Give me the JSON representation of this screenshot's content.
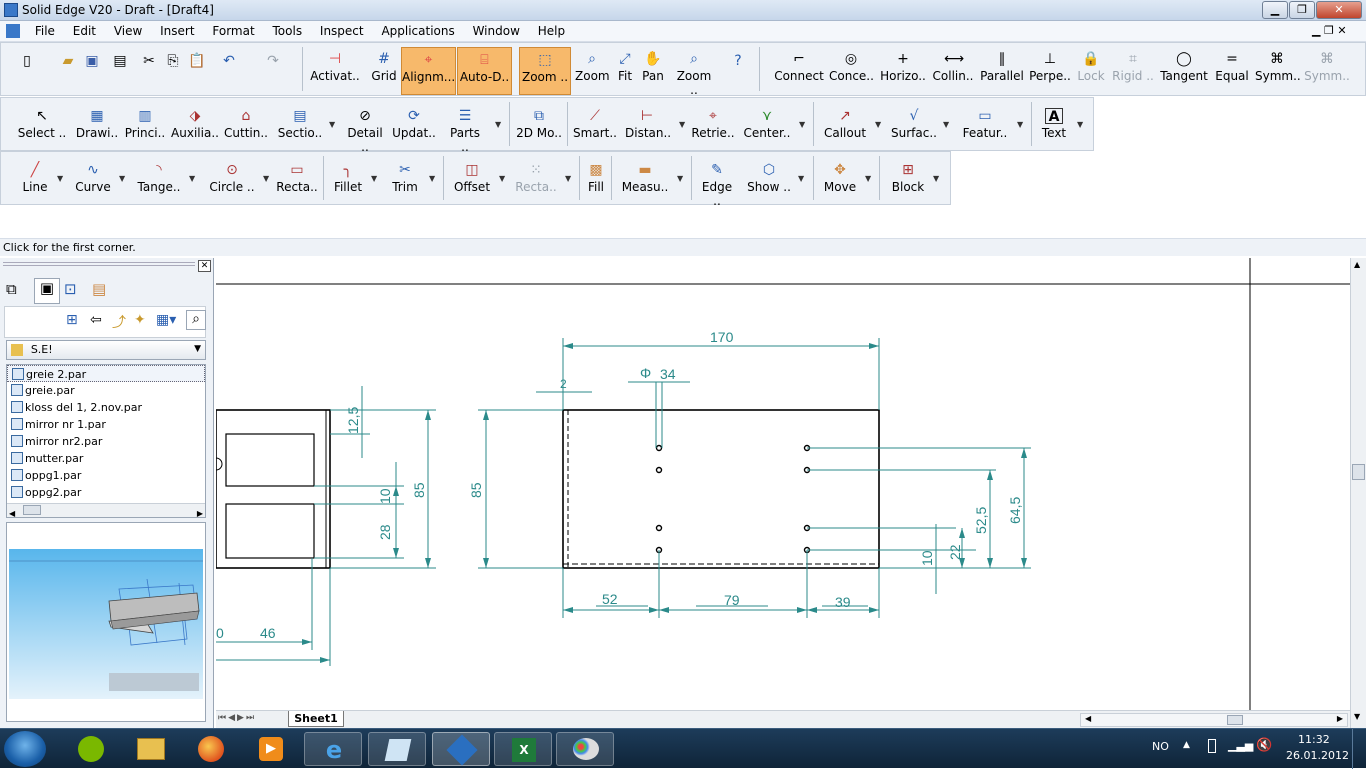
{
  "window": {
    "title": "Solid Edge V20 - Draft - [Draft4]"
  },
  "menu": [
    "File",
    "Edit",
    "View",
    "Insert",
    "Format",
    "Tools",
    "Inspect",
    "Applications",
    "Window",
    "Help"
  ],
  "toolbar1": [
    "Activat..",
    "Grid",
    "Alignm...",
    "Auto-D..",
    "Zoom ..",
    "Zoom",
    "Fit",
    "Pan",
    "Zoom .."
  ],
  "toolbar1b": [
    "Connect",
    "Conce..",
    "Horizo..",
    "Collin..",
    "Parallel",
    "Perpe..",
    "Lock",
    "Rigid ..",
    "Tangent",
    "Equal",
    "Symm..",
    "Symm.."
  ],
  "toolbar2": [
    "Select ..",
    "Drawi..",
    "Princi..",
    "Auxilia..",
    "Cuttin..",
    "Sectio..",
    "Detail ..",
    "Updat..",
    "Parts ..",
    "2D Mo..",
    "Smart..",
    "Distan..",
    "Retrie..",
    "Center..",
    "Callout",
    "Surfac..",
    "Featur..",
    "Text"
  ],
  "toolbar3": [
    "Line",
    "Curve",
    "Tange..",
    "Circle ..",
    "Recta..",
    "Fillet",
    "Trim",
    "Offset",
    "Recta..",
    "Fill",
    "Measu..",
    "Edge ..",
    "Show ..",
    "Move",
    "Block"
  ],
  "status": "Click for the first corner.",
  "library": {
    "folder": "S.E!",
    "files": [
      "greie 2.par",
      "greie.par",
      "kloss del 1, 2.nov.par",
      "mirror nr 1.par",
      "mirror nr2.par",
      "mutter.par",
      "oppg1.par",
      "oppg2.par"
    ]
  },
  "sheet_tab": "Sheet1",
  "drawing": {
    "dims": [
      "170",
      "34",
      "2",
      "85",
      "52",
      "79",
      "39",
      "64,5",
      "52,5",
      "22",
      "10",
      "12,5",
      "10",
      "28",
      "85",
      "46",
      "0"
    ],
    "diameter_symbol": "Φ"
  },
  "taskbar": {
    "lang": "NO",
    "time": "11:32",
    "date": "26.01.2012"
  },
  "colors": {
    "dim": "#2b8a8a",
    "highlight": "#f7b96b"
  }
}
